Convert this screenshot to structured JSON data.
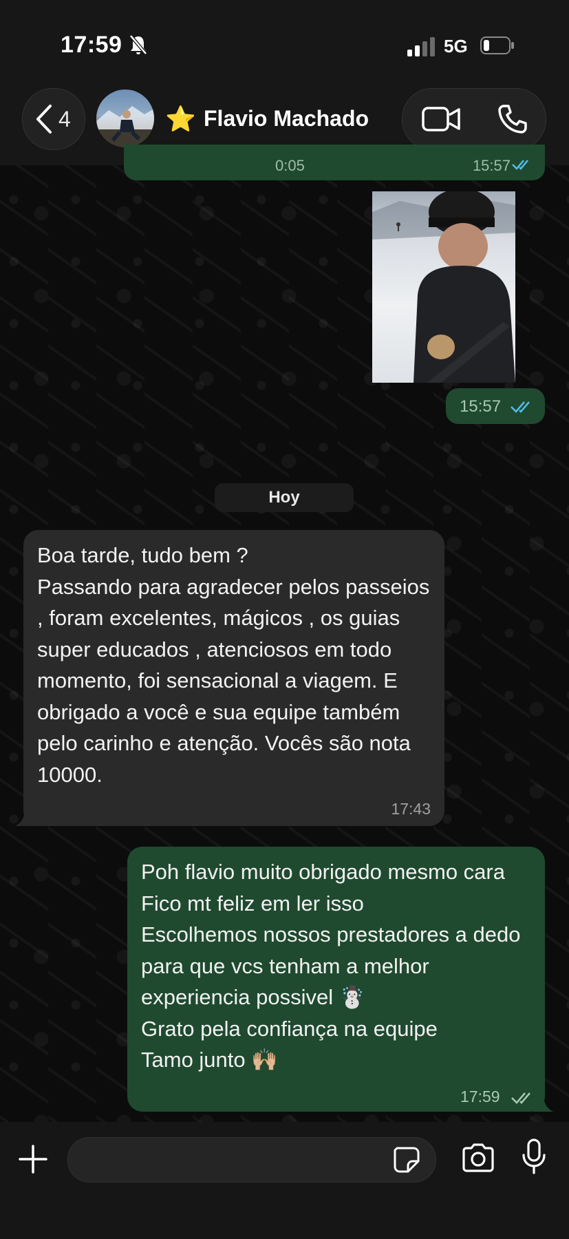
{
  "status_bar": {
    "time": "17:59",
    "network": "5G",
    "mute_icon": "bell-slash-icon",
    "signal_icon": "signal-bars-icon",
    "battery_icon": "battery-icon"
  },
  "header": {
    "back_count": "4",
    "contact_star": "⭐",
    "contact_name": "Flavio Machado",
    "video_icon": "video-camera-icon",
    "call_icon": "phone-icon"
  },
  "chat": {
    "previous_voice": {
      "duration": "0:05",
      "time": "15:57"
    },
    "photo_message": {
      "time": "15:57",
      "status": "read"
    },
    "date_separator": "Hoy",
    "incoming": {
      "text": "Boa tarde, tudo bem ?\nPassando para agradecer pelos passeios , foram excelentes, mágicos , os guias super educados , atenciosos em todo momento, foi sensacional a viagem. E obrigado a você e sua equipe também pelo carinho e atenção. Vocês são nota 10000.",
      "time": "17:43"
    },
    "outgoing": {
      "text": "Poh flavio muito obrigado mesmo cara\nFico mt feliz em ler isso\nEscolhemos nossos prestadores a dedo para que vcs tenham a melhor experiencia possivel ☃️\nGrato pela confiança na equipe\nTamo junto 🙌🏼",
      "time": "17:59",
      "status": "read"
    }
  },
  "composer": {
    "plus_icon": "plus-icon",
    "sticker_icon": "sticker-icon",
    "camera_icon": "camera-icon",
    "mic_icon": "microphone-icon"
  },
  "colors": {
    "outgoing_bubble": "#1f4a2f",
    "incoming_bubble": "#2a2a2a",
    "read_tick": "#53bdeb",
    "background": "#0b0b0b"
  }
}
